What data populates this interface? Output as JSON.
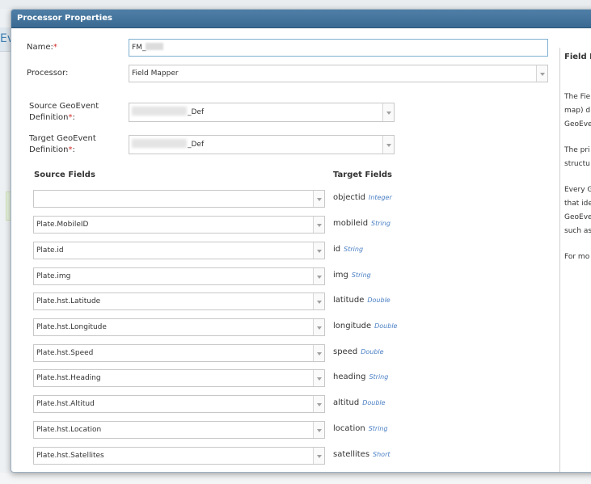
{
  "background": {
    "partial_text": "Ev"
  },
  "dialog": {
    "title": "Processor Properties",
    "name_label": "Name:",
    "required_mark": "*",
    "name_value": "FM_",
    "processor_label": "Processor:",
    "processor_value": "Field Mapper",
    "source_def_label_1": "Source GeoEvent",
    "source_def_label_2": "Definition",
    "source_def_label_suffix": ":",
    "source_def_value": "_Def",
    "target_def_label_1": "Target GeoEvent",
    "target_def_label_2": "Definition",
    "target_def_label_suffix": ":",
    "target_def_value": "_Def",
    "source_fields_header": "Source Fields",
    "target_fields_header": "Target Fields"
  },
  "mappings": [
    {
      "source": "",
      "target": "objectid",
      "type": "Integer"
    },
    {
      "source": "Plate.MobileID",
      "target": "mobileid",
      "type": "String"
    },
    {
      "source": "Plate.id",
      "target": "id",
      "type": "String"
    },
    {
      "source": "Plate.img",
      "target": "img",
      "type": "String"
    },
    {
      "source": "Plate.hst.Latitude",
      "target": "latitude",
      "type": "Double"
    },
    {
      "source": "Plate.hst.Longitude",
      "target": "longitude",
      "type": "Double"
    },
    {
      "source": "Plate.hst.Speed",
      "target": "speed",
      "type": "Double"
    },
    {
      "source": "Plate.hst.Heading",
      "target": "heading",
      "type": "String"
    },
    {
      "source": "Plate.hst.Altitud",
      "target": "altitud",
      "type": "Double"
    },
    {
      "source": "Plate.hst.Location",
      "target": "location",
      "type": "String"
    },
    {
      "source": "Plate.hst.Satellites",
      "target": "satellites",
      "type": "Short"
    }
  ],
  "help_panel": {
    "title": "Field M",
    "lines": [
      "The Fie",
      "map) d",
      "GeoEve",
      "",
      "The pri",
      "structu",
      "",
      "Every G",
      "that ide",
      "GeoEve",
      "such as",
      "",
      "For mo"
    ]
  }
}
